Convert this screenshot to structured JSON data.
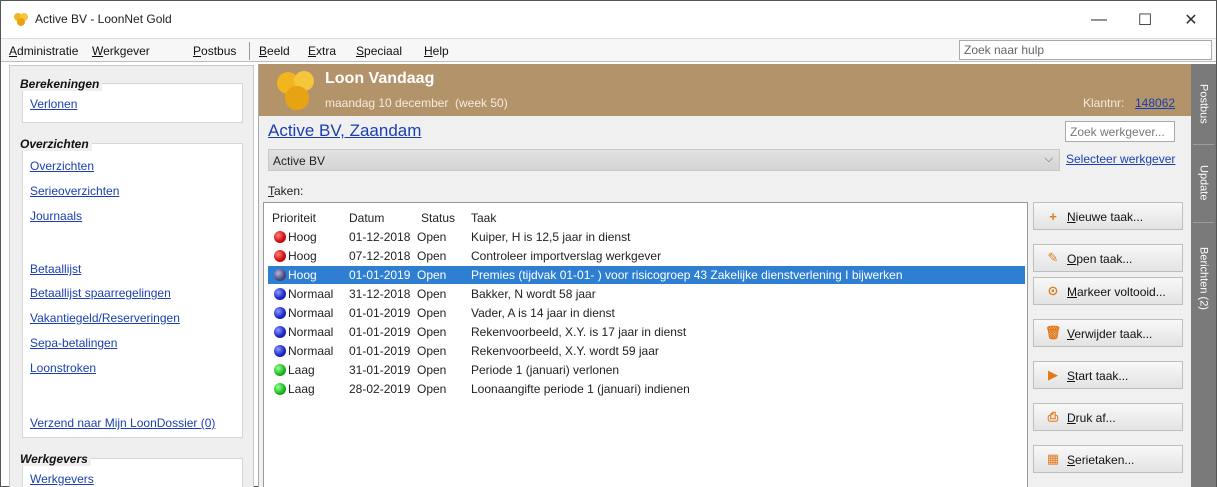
{
  "window": {
    "title": "Active BV - LoonNet Gold",
    "minimize": "—",
    "maximize": "☐",
    "close": "✕"
  },
  "menu": {
    "items": [
      "Administratie",
      "Werkgever",
      "Postbus",
      "Beeld",
      "Extra",
      "Speciaal",
      "Help"
    ],
    "help_search_placeholder": "Zoek naar hulp"
  },
  "sidebar": {
    "groups": [
      {
        "title": "Berekeningen",
        "links": [
          "Verlonen"
        ]
      },
      {
        "title": "Overzichten",
        "links": [
          "Overzichten",
          "Serieoverzichten",
          "Journaals",
          "Betaallijst",
          "Betaallijst spaarregelingen",
          "Vakantiegeld/Reserveringen",
          "Sepa-betalingen",
          "Loonstroken",
          "Verzend naar Mijn LoonDossier (0)"
        ]
      },
      {
        "title": "Werkgevers",
        "links": [
          "Werkgevers"
        ]
      }
    ]
  },
  "banner": {
    "title": "Loon Vandaag",
    "date": "maandag 10 december",
    "week": "(week 50)",
    "klant_label": "Klantnr:",
    "klant_number": "148062"
  },
  "employer": {
    "title": "Active BV, Zaandam",
    "search_placeholder": "Zoek werkgever...",
    "selected": "Active BV",
    "select_link": "Selecteer werkgever"
  },
  "tasks": {
    "label": "Taken:",
    "columns": [
      "Prioriteit",
      "Datum",
      "Status",
      "Taak"
    ],
    "rows": [
      {
        "priority": "Hoog",
        "color": "red",
        "date": "01-12-2018",
        "status": "Open",
        "task": "Kuiper, H is 12,5 jaar in dienst",
        "selected": false
      },
      {
        "priority": "Hoog",
        "color": "red",
        "date": "07-12-2018",
        "status": "Open",
        "task": "Controleer importverslag werkgever",
        "selected": false
      },
      {
        "priority": "Hoog",
        "color": "selected",
        "date": "01-01-2019",
        "status": "Open",
        "task": "Premies (tijdvak 01-01-        ) voor risicogroep 43 Zakelijke dienstverlening I bijwerken",
        "selected": true
      },
      {
        "priority": "Normaal",
        "color": "blue",
        "date": "31-12-2018",
        "status": "Open",
        "task": "Bakker, N wordt 58 jaar",
        "selected": false
      },
      {
        "priority": "Normaal",
        "color": "blue",
        "date": "01-01-2019",
        "status": "Open",
        "task": "Vader, A is 14 jaar in dienst",
        "selected": false
      },
      {
        "priority": "Normaal",
        "color": "blue",
        "date": "01-01-2019",
        "status": "Open",
        "task": "Rekenvoorbeeld, X.Y. is 17 jaar in dienst",
        "selected": false
      },
      {
        "priority": "Normaal",
        "color": "blue",
        "date": "01-01-2019",
        "status": "Open",
        "task": "Rekenvoorbeeld, X.Y. wordt 59 jaar",
        "selected": false
      },
      {
        "priority": "Laag",
        "color": "green",
        "date": "31-01-2019",
        "status": "Open",
        "task": "Periode 1 (januari) verlonen",
        "selected": false
      },
      {
        "priority": "Laag",
        "color": "green",
        "date": "28-02-2019",
        "status": "Open",
        "task": "Loonaangifte periode 1 (januari) indienen",
        "selected": false
      }
    ]
  },
  "actions": [
    {
      "label": "Nieuwe taak...",
      "icon": "plus-icon",
      "glyph": "+",
      "color": "#e07a1a"
    },
    {
      "label": "Open taak...",
      "icon": "edit-icon",
      "glyph": "✎",
      "color": "#e07a1a"
    },
    {
      "label": "Markeer voltooid...",
      "icon": "check-circle-icon",
      "glyph": "⊙",
      "color": "#e07a1a"
    },
    {
      "label": "Verwijder taak...",
      "icon": "trash-icon",
      "glyph": "🗑",
      "color": "#e07a1a"
    },
    {
      "label": "Start taak...",
      "icon": "play-icon",
      "glyph": "▶",
      "color": "#e07a1a"
    },
    {
      "label": "Druk af...",
      "icon": "printer-icon",
      "glyph": "⎙",
      "color": "#e07a1a"
    },
    {
      "label": "Serietaken...",
      "icon": "calendar-icon",
      "glyph": "▦",
      "color": "#e07a1a"
    }
  ],
  "right_tabs": [
    "Postbus",
    "Update",
    "Berichten (2)"
  ],
  "colors": {
    "banner": "#b3936a",
    "link": "#1a3fb0",
    "selection": "#2e7fd2",
    "right_tabs": "#7a7a7a"
  }
}
